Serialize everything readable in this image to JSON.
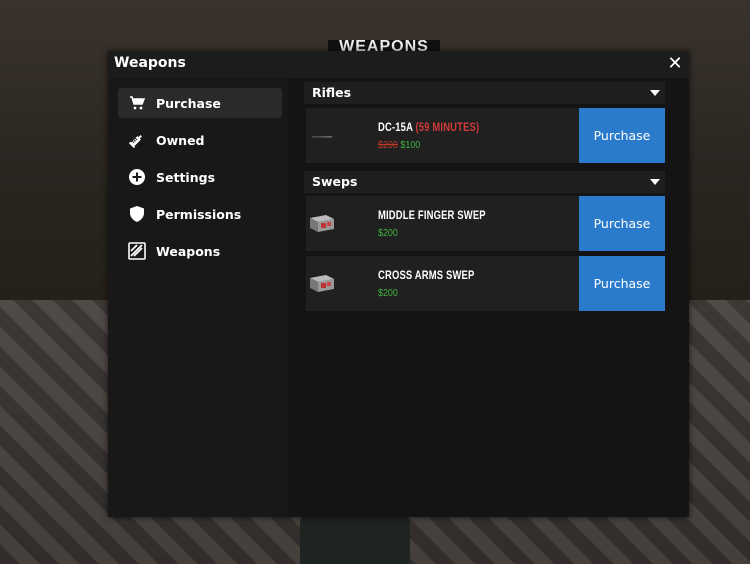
{
  "background": {
    "sign_text": "WEAPONS"
  },
  "window": {
    "title": "Weapons",
    "close_glyph": "✕"
  },
  "sidebar": {
    "items": [
      {
        "label": "Purchase",
        "icon": "cart-icon",
        "active": true
      },
      {
        "label": "Owned",
        "icon": "syringe-icon",
        "active": false
      },
      {
        "label": "Settings",
        "icon": "plus-circle-icon",
        "active": false
      },
      {
        "label": "Permissions",
        "icon": "shield-icon",
        "active": false
      },
      {
        "label": "Weapons",
        "icon": "weapons-icon",
        "active": false
      }
    ]
  },
  "categories": [
    {
      "title": "Rifles",
      "items": [
        {
          "name": "DC-15A",
          "timer": "(59 MINUTES)",
          "old_price": "$200",
          "price": "$100",
          "button": "Purchase",
          "thumb": "rifle"
        }
      ]
    },
    {
      "title": "Sweps",
      "items": [
        {
          "name": "MIDDLE FINGER SWEP",
          "timer": "",
          "old_price": "",
          "price": "$200",
          "button": "Purchase",
          "thumb": "box"
        },
        {
          "name": "CROSS ARMS SWEP",
          "timer": "",
          "old_price": "",
          "price": "$200",
          "button": "Purchase",
          "thumb": "box"
        }
      ]
    }
  ],
  "colors": {
    "accent": "#2a7bcc",
    "price_green": "#3fb33f",
    "price_old_red": "#c0392b",
    "timer_red": "#d23b3b"
  }
}
